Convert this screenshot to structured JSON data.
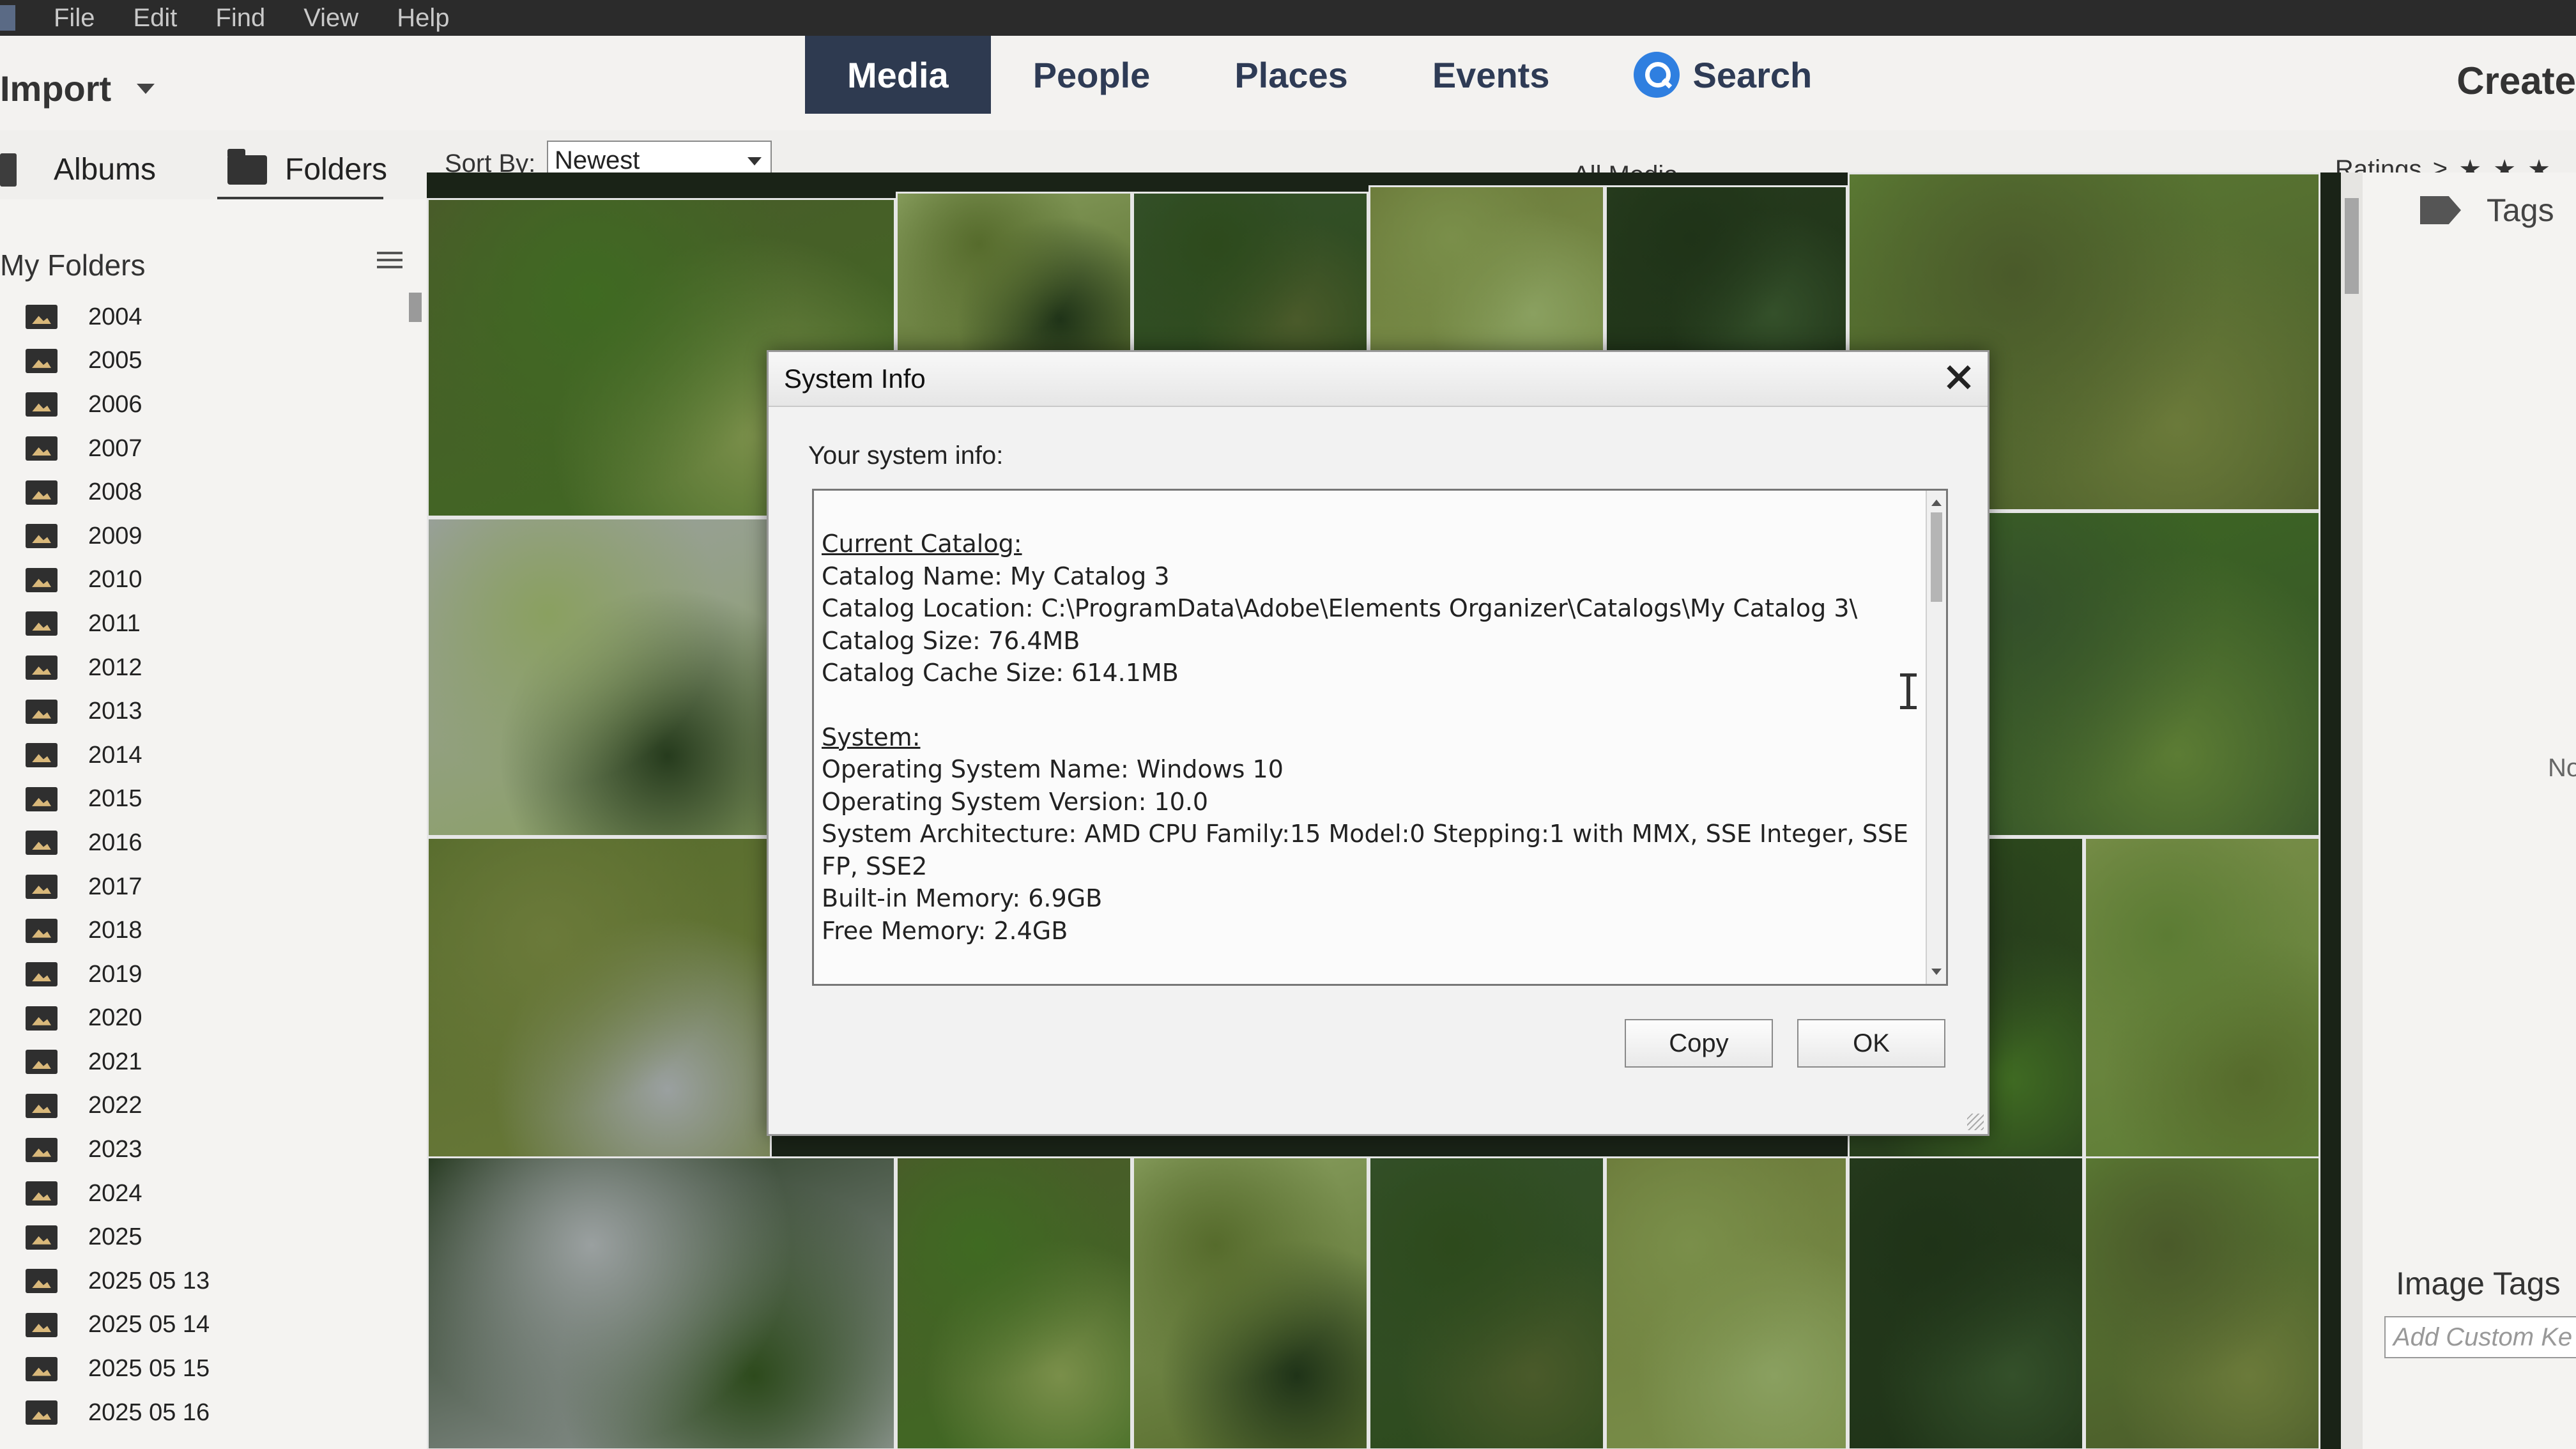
{
  "menubar": {
    "items": [
      "File",
      "Edit",
      "Find",
      "View",
      "Help"
    ]
  },
  "header": {
    "import_label": "Import",
    "tabs": [
      {
        "label": "Media",
        "active": true
      },
      {
        "label": "People"
      },
      {
        "label": "Places"
      },
      {
        "label": "Events"
      }
    ],
    "search_label": "Search",
    "create_label": "Create"
  },
  "subbar": {
    "albums_label": "Albums",
    "folders_label": "Folders",
    "sort_label": "Sort By:",
    "sort_value": "Newest",
    "view_title": "All Media",
    "ratings_label": "Ratings",
    "ratings_symbol": "≥",
    "stars": [
      "★",
      "★",
      "★"
    ]
  },
  "sidebar": {
    "title": "My Folders",
    "folders": [
      "2004",
      "2005",
      "2006",
      "2007",
      "2008",
      "2009",
      "2010",
      "2011",
      "2012",
      "2013",
      "2014",
      "2015",
      "2016",
      "2017",
      "2018",
      "2019",
      "2020",
      "2021",
      "2022",
      "2023",
      "2024",
      "2025",
      "2025 05 13",
      "2025 05 14",
      "2025 05 15",
      "2025 05 16"
    ]
  },
  "rightpanel": {
    "tags_label": "Tags",
    "no_text": "No",
    "image_tags_label": "Image Tags",
    "custom_keyword_placeholder": "Add Custom Ke"
  },
  "dialog": {
    "title": "System Info",
    "prompt": "Your system info:",
    "sections": [
      {
        "heading": "Current Catalog:",
        "lines": [
          "Catalog Name: My Catalog 3",
          "Catalog Location: C:\\ProgramData\\Adobe\\Elements Organizer\\Catalogs\\My Catalog 3\\",
          "Catalog Size: 76.4MB",
          "Catalog Cache Size: 614.1MB"
        ]
      },
      {
        "heading": "System:",
        "lines": [
          "Operating System Name: Windows 10",
          "Operating System Version: 10.0",
          "System Architecture: AMD CPU Family:15 Model:0 Stepping:1 with MMX, SSE Integer, SSE",
          "FP, SSE2",
          "Built-in Memory: 6.9GB",
          "Free Memory: 2.4GB"
        ]
      }
    ],
    "copy_label": "Copy",
    "ok_label": "OK"
  },
  "colors": {
    "active_tab": "#2e3a50",
    "tab_text": "#2e3b55",
    "search_accent": "#2f7fe0",
    "photo_tones": [
      "#3f6a22",
      "#566b2c",
      "#2d4a1c",
      "#7a8f4a",
      "#1f3318",
      "#4a5a2a",
      "#8aa060",
      "#34502a",
      "#6b7a3a",
      "#263b1d",
      "#5c7c34",
      "#9aa0a0"
    ]
  }
}
